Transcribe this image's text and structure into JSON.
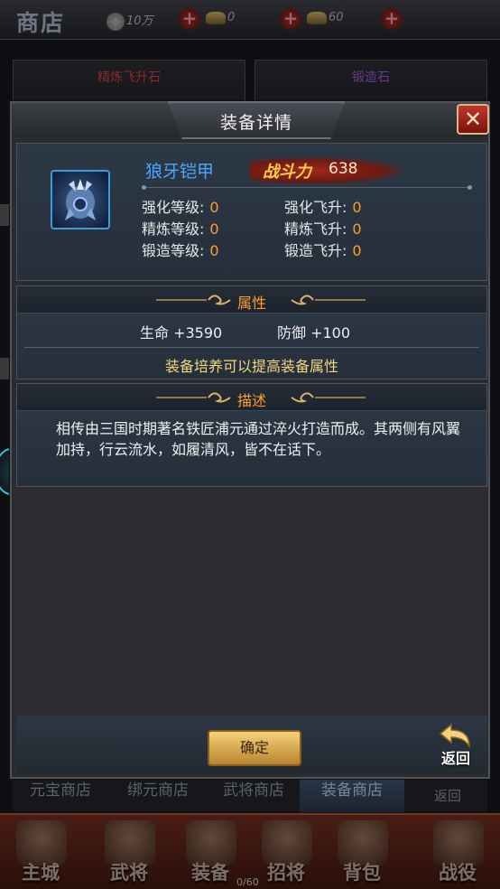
{
  "shop": {
    "title": "商店",
    "silver": "10万",
    "yuanbao": "0",
    "bound_yuanbao": "60",
    "cards": [
      {
        "name": "精炼飞升石",
        "color": "#8a2a2a"
      },
      {
        "name": "锻造石",
        "color": "#6a3a8a"
      }
    ],
    "tabs": [
      "元宝商店",
      "绑元商店",
      "武将商店",
      "装备商店"
    ],
    "active_tab": "装备商店",
    "back_label": "返回"
  },
  "nav": {
    "items": [
      "主城",
      "武将",
      "装备",
      "招将",
      "背包",
      "战役"
    ],
    "bag_count": "0/60"
  },
  "modal": {
    "title": "装备详情",
    "close_icon": "close-x-icon",
    "item": {
      "name": "狼牙铠甲",
      "name_color": "#49a7ff",
      "power_label": "战斗力",
      "power_value": "638",
      "icon": "armor-icon"
    },
    "stats": [
      {
        "label": "强化等级:",
        "value": "0"
      },
      {
        "label": "强化飞升:",
        "value": "0"
      },
      {
        "label": "精炼等级:",
        "value": "0"
      },
      {
        "label": "精炼飞升:",
        "value": "0"
      },
      {
        "label": "锻造等级:",
        "value": "0"
      },
      {
        "label": "锻造飞升:",
        "value": "0"
      }
    ],
    "attributes": {
      "title": "属性",
      "items": [
        "生命 +3590",
        "防御 +100"
      ],
      "hint": "装备培养可以提高装备属性"
    },
    "description": {
      "title": "描述",
      "text": "相传由三国时期著名铁匠浦元通过淬火打造而成。其两侧有风翼加持，行云流水，如履清风，皆不在话下。"
    },
    "confirm_label": "确定",
    "back_label": "返回"
  },
  "colors": {
    "accent_orange": "#ff9d2a",
    "hint_yellow": "#f1d77a",
    "item_blue": "#49a7ff",
    "close_red": "#c2372a"
  }
}
